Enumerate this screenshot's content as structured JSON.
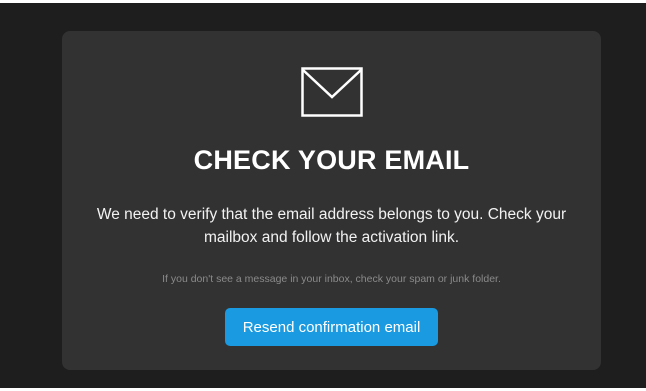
{
  "card": {
    "icon": "envelope-icon",
    "title": "CHECK YOUR EMAIL",
    "message": "We need to verify that the email address belongs to you. Check your mailbox and follow the activation link.",
    "hint": "If you don't see a message in your inbox, check your spam or junk folder.",
    "resend_button_label": "Resend confirmation email"
  },
  "colors": {
    "background": "#1e1e1e",
    "card": "#323233",
    "accent": "#1a9ae0",
    "hint_text": "#8a8a8a"
  }
}
